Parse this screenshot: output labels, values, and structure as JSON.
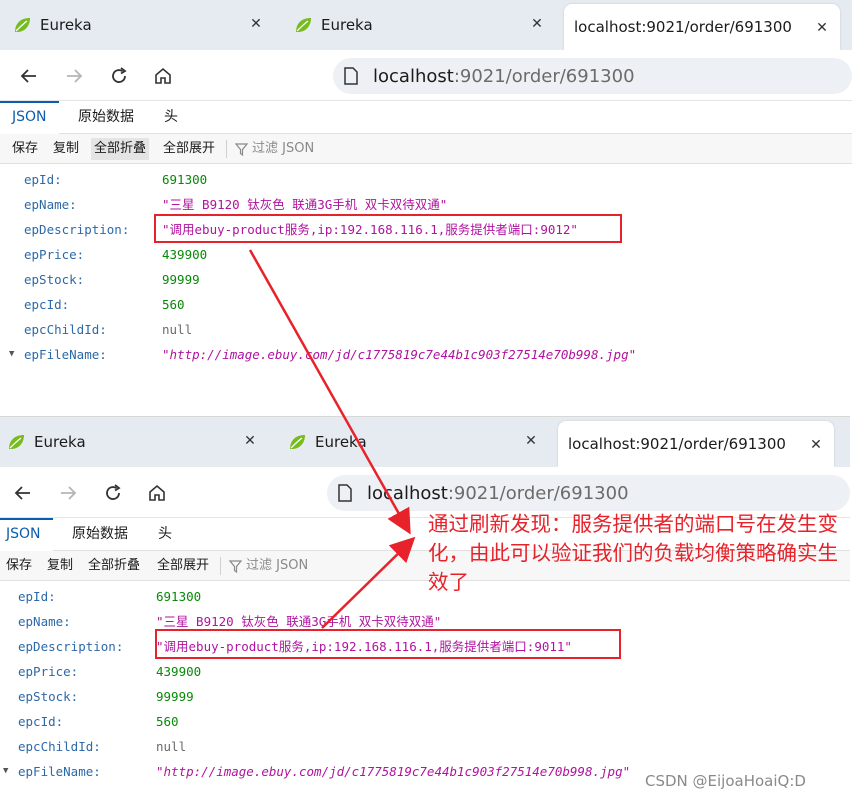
{
  "browser": {
    "tabs": [
      {
        "title": "Eureka",
        "icon": "spring-leaf-icon"
      },
      {
        "title": "Eureka",
        "icon": "spring-leaf-icon"
      },
      {
        "title": "localhost:9021/order/691300",
        "icon": ""
      }
    ],
    "close_glyph": "✕",
    "url_host": "localhost",
    "url_path": ":9021/order/691300"
  },
  "viewer": {
    "tabs": [
      "JSON",
      "原始数据",
      "头"
    ],
    "toolbar": [
      "保存",
      "复制",
      "全部折叠",
      "全部展开"
    ],
    "filter_placeholder": "过滤 JSON"
  },
  "first_response": {
    "rows": [
      {
        "key": "epId:",
        "value": "691300",
        "kind": "num"
      },
      {
        "key": "epName:",
        "value": "\"三星 B9120 钛灰色 联通3G手机 双卡双待双通\"",
        "kind": "str"
      },
      {
        "key": "epDescription:",
        "value": "\"调用ebuy-product服务,ip:192.168.116.1,服务提供者端口:9012\"",
        "kind": "str"
      },
      {
        "key": "epPrice:",
        "value": "439900",
        "kind": "num"
      },
      {
        "key": "epStock:",
        "value": "99999",
        "kind": "num"
      },
      {
        "key": "epcId:",
        "value": "560",
        "kind": "num"
      },
      {
        "key": "epcChildId:",
        "value": "null",
        "kind": "nul"
      },
      {
        "key": "epFileName:",
        "value": "\"http://image.ebuy.com/jd/c1775819c7e44b1c903f27514e70b998.jpg\"",
        "kind": "url"
      }
    ]
  },
  "second_response": {
    "rows": [
      {
        "key": "epId:",
        "value": "691300",
        "kind": "num"
      },
      {
        "key": "epName:",
        "value": "\"三星 B9120 钛灰色 联通3G手机 双卡双待双通\"",
        "kind": "str"
      },
      {
        "key": "epDescription:",
        "value": "\"调用ebuy-product服务,ip:192.168.116.1,服务提供者端口:9011\"",
        "kind": "str"
      },
      {
        "key": "epPrice:",
        "value": "439900",
        "kind": "num"
      },
      {
        "key": "epStock:",
        "value": "99999",
        "kind": "num"
      },
      {
        "key": "epcId:",
        "value": "560",
        "kind": "num"
      },
      {
        "key": "epcChildId:",
        "value": "null",
        "kind": "nul"
      },
      {
        "key": "epFileName:",
        "value": "\"http://image.ebuy.com/jd/c1775819c7e44b1c903f27514e70b998.jpg\"",
        "kind": "url"
      }
    ]
  },
  "annotation": {
    "text": "通过刷新发现：服务提供者的端口号在发生变化，由此可以验证我们的负载均衡策略确实生效了",
    "color": "#e8222a"
  },
  "watermark": "CSDN @EijoaHoaiQ:D",
  "colors": {
    "key": "#2d69a8",
    "string": "#b0139f",
    "number": "#078907",
    "accent": "#0b5cad",
    "highlight": "#e8222a"
  }
}
